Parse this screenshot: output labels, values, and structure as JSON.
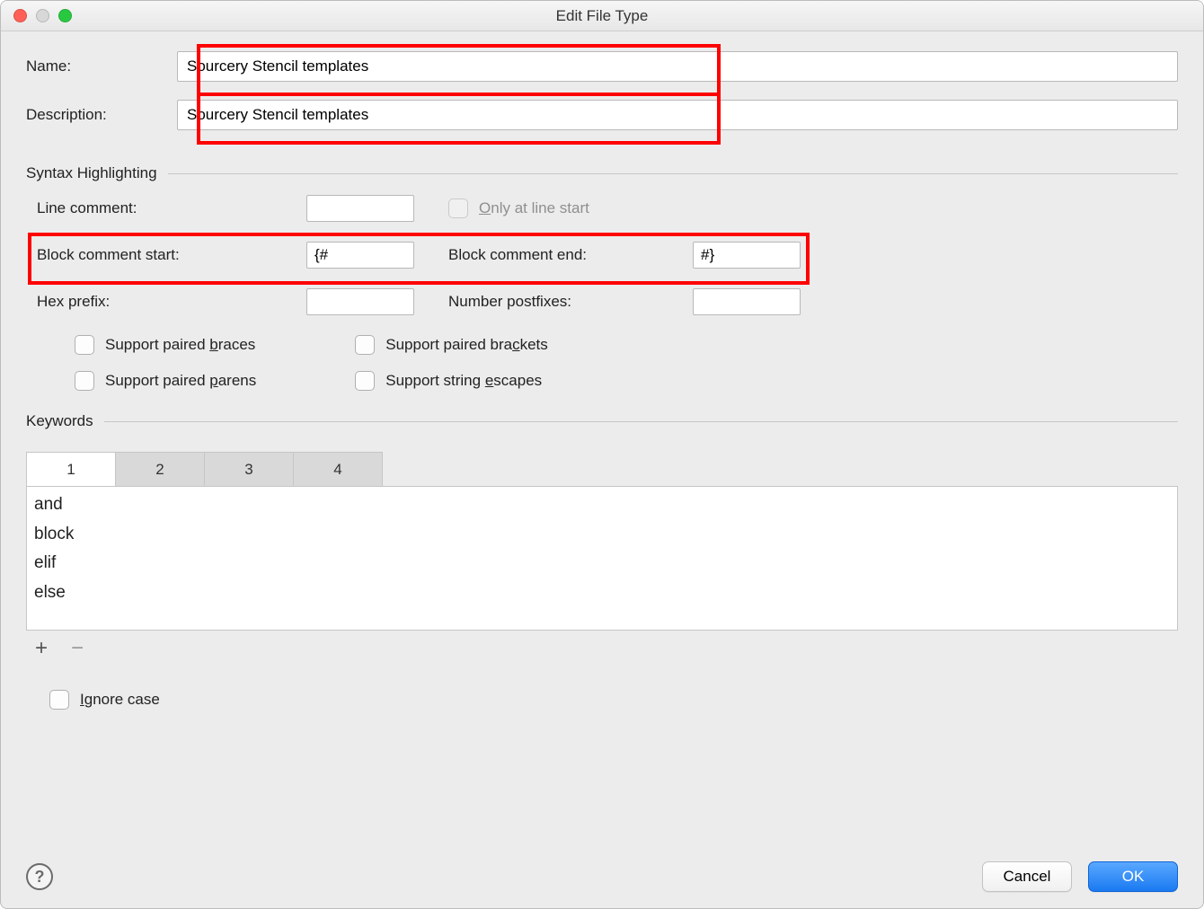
{
  "window": {
    "title": "Edit File Type"
  },
  "fields": {
    "name_label": "Name:",
    "name_value": "Sourcery Stencil templates",
    "description_label": "Description:",
    "description_value": "Sourcery Stencil templates"
  },
  "syntax": {
    "section_title": "Syntax Highlighting",
    "line_comment_label": "Line comment:",
    "line_comment_value": "",
    "only_at_line_start_label": "Only at line start",
    "block_start_label": "Block comment start:",
    "block_start_value": "{#",
    "block_end_label": "Block comment end:",
    "block_end_value": "#}",
    "hex_prefix_label": "Hex prefix:",
    "hex_prefix_value": "",
    "number_postfixes_label": "Number postfixes:",
    "number_postfixes_value": "",
    "support_braces_label": "Support paired braces",
    "support_brackets_label": "Support paired brackets",
    "support_parens_label": "Support paired parens",
    "support_escapes_label": "Support string escapes"
  },
  "keywords": {
    "section_title": "Keywords",
    "tabs": [
      "1",
      "2",
      "3",
      "4"
    ],
    "active_tab": 0,
    "items": [
      "and",
      "block",
      "elif",
      "else"
    ],
    "ignore_case_label": "Ignore case"
  },
  "footer": {
    "cancel": "Cancel",
    "ok": "OK"
  }
}
